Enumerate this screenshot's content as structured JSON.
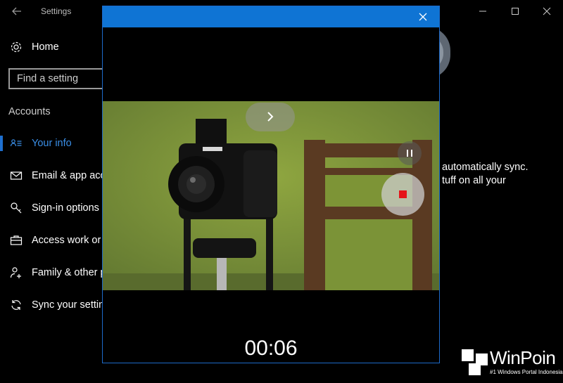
{
  "settings": {
    "title": "Settings",
    "home_label": "Home",
    "search_placeholder": "Find a setting",
    "section_label": "Accounts",
    "nav": [
      {
        "label": "Your info",
        "icon": "person-card-icon"
      },
      {
        "label": "Email & app acc",
        "icon": "mail-icon"
      },
      {
        "label": "Sign-in options",
        "icon": "key-icon"
      },
      {
        "label": "Access work or",
        "icon": "briefcase-icon"
      },
      {
        "label": "Family & other p",
        "icon": "person-add-icon"
      },
      {
        "label": "Sync your settin",
        "icon": "sync-icon"
      }
    ],
    "right_text_line1": "automatically sync.",
    "right_text_line2": "tuff on all your",
    "accent_color": "#1e6fcf"
  },
  "camera": {
    "timer": "00:06",
    "titlebar_color": "#0f74d4",
    "record_color": "#e5141a"
  },
  "watermark": {
    "name": "WinPoin",
    "tagline": "#1 Windows Portal Indonesia"
  }
}
